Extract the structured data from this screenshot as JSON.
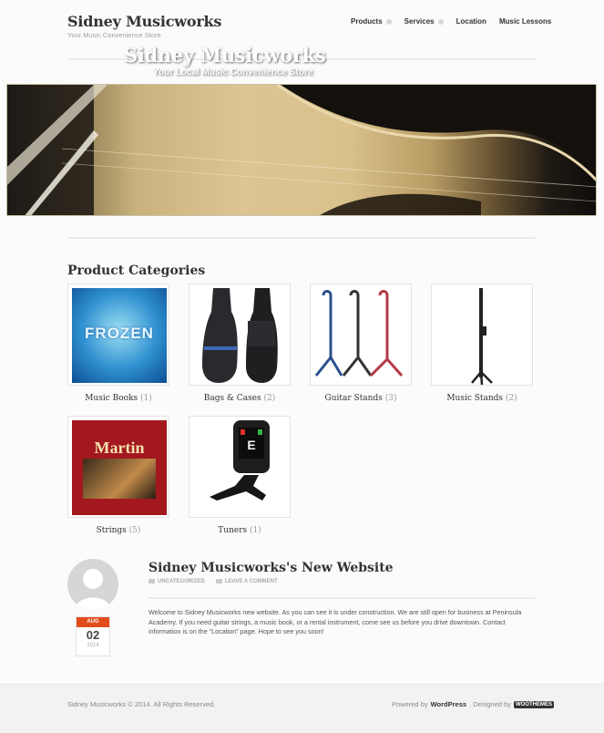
{
  "site": {
    "title": "Sidney Musicworks",
    "tagline": "Your Music Convenience Store"
  },
  "nav": {
    "items": [
      {
        "label": "Products",
        "has_dropdown": true
      },
      {
        "label": "Services",
        "has_dropdown": true
      },
      {
        "label": "Location",
        "has_dropdown": false
      },
      {
        "label": "Music Lessons",
        "has_dropdown": false
      }
    ]
  },
  "hero": {
    "title": "Sidney Musicworks",
    "subtitle": "Your Local Music Convenience Store"
  },
  "categories": {
    "heading": "Product Categories",
    "items": [
      {
        "name": "Music Books",
        "count": "(1)",
        "image_icon": "frozen-book-image"
      },
      {
        "name": "Bags & Cases",
        "count": "(2)",
        "image_icon": "guitar-bags-image"
      },
      {
        "name": "Guitar Stands",
        "count": "(3)",
        "image_icon": "guitar-stands-image"
      },
      {
        "name": "Music Stands",
        "count": "(2)",
        "image_icon": "music-stand-image"
      },
      {
        "name": "Strings",
        "count": "(5)",
        "image_icon": "martin-strings-image"
      },
      {
        "name": "Tuners",
        "count": "(1)",
        "image_icon": "clip-tuner-image"
      }
    ]
  },
  "post": {
    "title": "Sidney Musicworks's New Website",
    "category": "UNCATEGORIZED",
    "comment_link": "LEAVE A COMMENT",
    "date": {
      "month": "AUG",
      "day": "02",
      "year": "2014"
    },
    "body": "Welcome to Sidney Musicworks new website. As you can see it is under construction.  We are still open for business at Peninsula Academy.  If you need guitar strings, a music book, or a rental instrument, come see us before you drive downtown. Contact information is on the “Location” page. Hope to see you soon!"
  },
  "footer": {
    "copyright": "Sidney Musicworks © 2014. All Rights Reserved.",
    "powered_prefix": "Powered by",
    "powered_link": "WordPress",
    "designed_prefix": ". Designed by",
    "designer_logo": "WOOTHEMES"
  },
  "colors": {
    "accent": "#e24c1c",
    "text": "#333333",
    "background": "#fbfbfb"
  }
}
